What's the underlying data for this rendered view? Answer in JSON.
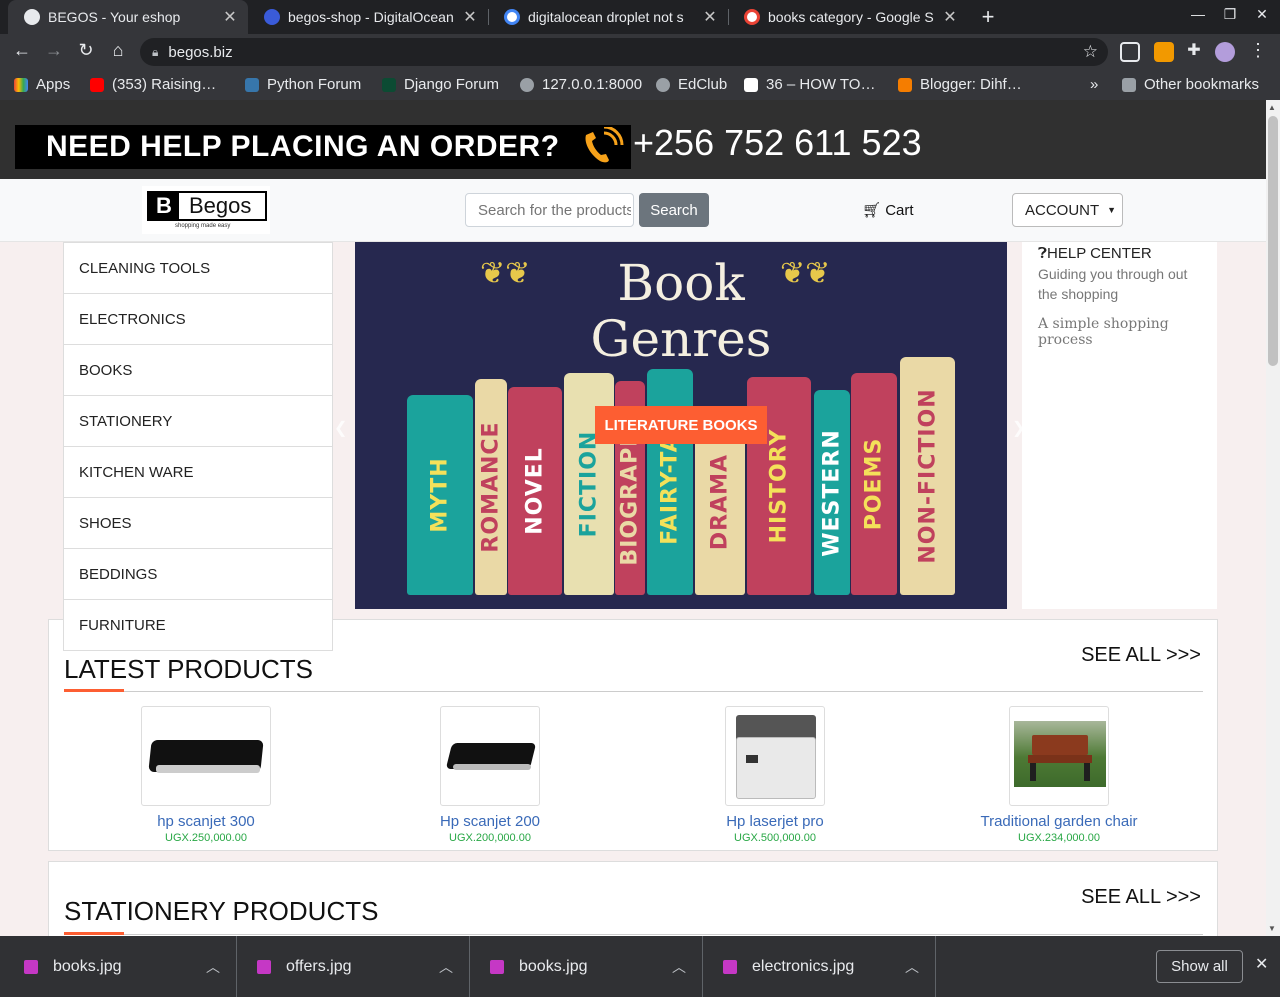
{
  "browser": {
    "tabs": [
      {
        "title": "BEGOS - Your eshop",
        "active": true,
        "favicon_color": "#e8eaed"
      },
      {
        "title": "begos-shop - DigitalOcean",
        "active": false,
        "favicon_color": "#3a5bd9"
      },
      {
        "title": "digitalocean droplet not s",
        "active": false,
        "favicon_color": "#ffffff"
      },
      {
        "title": "books category - Google S",
        "active": false,
        "favicon_color": "#ffffff"
      }
    ],
    "new_tab": "+",
    "url": "begos.biz",
    "bookmarks": [
      {
        "label": "Apps",
        "color": "#ea4335"
      },
      {
        "label": "(353) Raising…",
        "color": "#ff0000"
      },
      {
        "label": "Python Forum",
        "color": "#3776ab"
      },
      {
        "label": "Django Forum",
        "color": "#0c4b33"
      },
      {
        "label": "127.0.0.1:8000",
        "color": "#9aa0a6"
      },
      {
        "label": "EdClub",
        "color": "#9aa0a6"
      },
      {
        "label": "36 – HOW TO…",
        "color": "#ffffff"
      },
      {
        "label": "Blogger: Dihf…",
        "color": "#f57d00"
      }
    ],
    "bookmarks_more": "»",
    "other_bookmarks": "Other bookmarks"
  },
  "help_banner": {
    "text": "NEED HELP PLACING AN ORDER?",
    "phone": "+256 752 611 523"
  },
  "navbar": {
    "logo_letter": "B",
    "logo_name": "Begos",
    "logo_tagline": "shopping made easy",
    "search_placeholder": "Search for the products",
    "search_button": "Search",
    "cart": "Cart",
    "account": "ACCOUNT"
  },
  "categories": [
    "CLEANING TOOLS",
    "ELECTRONICS",
    "BOOKS",
    "STATIONERY",
    "KITCHEN WARE",
    "SHOES",
    "BEDDINGS",
    "FURNITURE"
  ],
  "carousel": {
    "heading_line1": "Book",
    "heading_line2": "Genres",
    "caption_button": "LITERATURE BOOKS",
    "books": [
      {
        "label": "MYTH",
        "color": "#1ba39c",
        "text_color": "#f4e15a"
      },
      {
        "label": "ROMANCE",
        "color": "#ead9a6",
        "text_color": "#c0415d"
      },
      {
        "label": "NOVEL",
        "color": "#c0415d",
        "text_color": "#ffffff"
      },
      {
        "label": "FICTION",
        "color": "#e8e0b0",
        "text_color": "#1ba39c"
      },
      {
        "label": "BIOGRAPHY",
        "color": "#c0415d",
        "text_color": "#ead9a6"
      },
      {
        "label": "FAIRY-TAL",
        "color": "#1ba39c",
        "text_color": "#f4e15a"
      },
      {
        "label": "DRAMA",
        "color": "#ead9a6",
        "text_color": "#c0415d"
      },
      {
        "label": "HISTORY",
        "color": "#c0415d",
        "text_color": "#f4e15a"
      },
      {
        "label": "WESTERN",
        "color": "#1ba39c",
        "text_color": "#ffffff"
      },
      {
        "label": "POEMS",
        "color": "#c0415d",
        "text_color": "#f4e15a"
      },
      {
        "label": "NON-FICTION",
        "color": "#ead9a6",
        "text_color": "#c0415d"
      }
    ]
  },
  "help_center": {
    "title": "HELP CENTER",
    "subtitle": "Guiding you through out the shopping",
    "note": "A simple shopping process"
  },
  "latest": {
    "title": "LATEST PRODUCTS",
    "see_all": "SEE ALL >>>",
    "products": [
      {
        "name": "hp scanjet 300",
        "price": "UGX.250,000.00",
        "image": "scanner-image"
      },
      {
        "name": "Hp scanjet 200",
        "price": "UGX.200,000.00",
        "image": "scanner-image"
      },
      {
        "name": "Hp laserjet pro",
        "price": "UGX.500,000.00",
        "image": "printer-image"
      },
      {
        "name": "Traditional garden chair",
        "price": "UGX.234,000.00",
        "image": "garden-chair-image"
      }
    ]
  },
  "stationery": {
    "title": "STATIONERY PRODUCTS",
    "see_all": "SEE ALL >>>"
  },
  "downloads": {
    "items": [
      "books.jpg",
      "offers.jpg",
      "books.jpg",
      "electronics.jpg"
    ],
    "show_all": "Show all"
  },
  "colors": {
    "accent": "#fd5e32",
    "price_green": "#28a745",
    "link_blue": "#3a6ab8"
  }
}
